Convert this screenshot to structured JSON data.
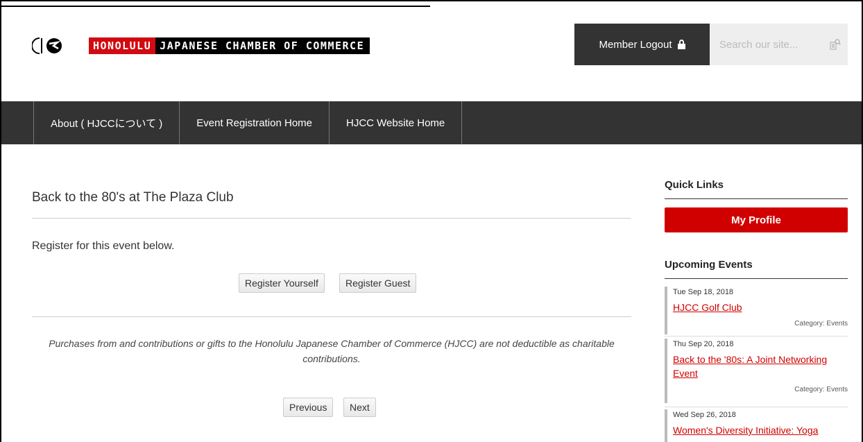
{
  "header": {
    "logo_word_red": "HONOLULU",
    "logo_word_rest": "JAPANESE CHAMBER OF COMMERCE",
    "member_logout_label": "Member Logout",
    "search_placeholder": "Search our site..."
  },
  "nav": {
    "items": [
      {
        "label": "About ( HJCCについて )"
      },
      {
        "label": "Event Registration Home"
      },
      {
        "label": "HJCC Website Home"
      }
    ]
  },
  "main": {
    "event_title": "Back to the 80's at The Plaza Club",
    "register_intro": "Register for this event below.",
    "register_yourself_label": "Register Yourself",
    "register_guest_label": "Register Guest",
    "disclaimer": "Purchases from and contributions or gifts to the Honolulu Japanese Chamber of Commerce (HJCC) are not deductible as charitable contributions.",
    "previous_label": "Previous",
    "next_label": "Next"
  },
  "sidebar": {
    "quick_links_heading": "Quick Links",
    "my_profile_label": "My Profile",
    "upcoming_events_heading": "Upcoming Events",
    "events": [
      {
        "date": "Tue Sep 18, 2018",
        "title": "HJCC Golf Club",
        "category": "Category: Events"
      },
      {
        "date": "Thu Sep 20, 2018",
        "title": "Back to the '80s: A Joint Networking Event",
        "category": "Category: Events"
      },
      {
        "date": "Wed Sep 26, 2018",
        "title": "Women's Diversity Initiative: Yoga",
        "category": ""
      }
    ]
  },
  "colors": {
    "brand_red": "#d10000",
    "nav_dark": "#333333"
  }
}
